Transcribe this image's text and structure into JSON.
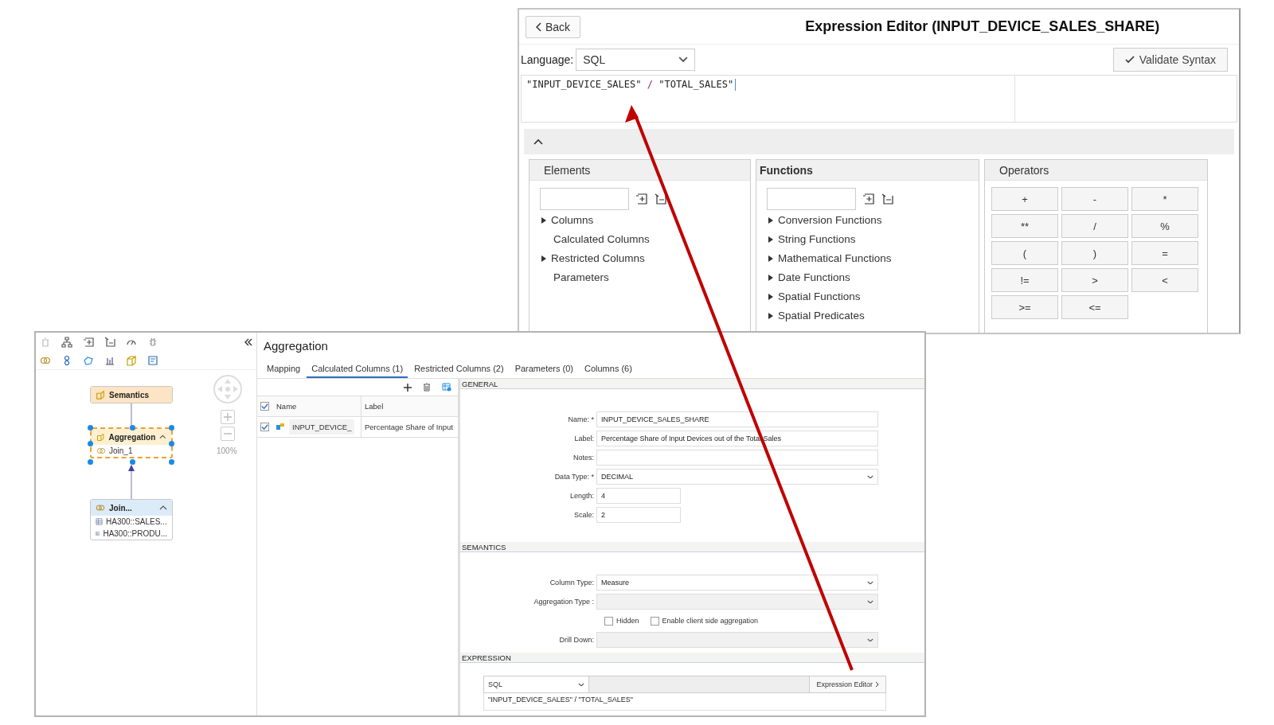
{
  "expression_editor": {
    "back_button": "Back",
    "title": "Expression Editor (INPUT_DEVICE_SALES_SHARE)",
    "language_label": "Language:",
    "language": "SQL",
    "validate_button": "Validate Syntax",
    "code": [
      {
        "kind": "string",
        "text": "\"INPUT_DEVICE_SALES\""
      },
      {
        "kind": "operator",
        "text": "/"
      },
      {
        "kind": "string",
        "text": "\"TOTAL_SALES\""
      }
    ],
    "elements": {
      "title": "Elements",
      "items": [
        {
          "label": "Columns",
          "expandable": true
        },
        {
          "label": "Calculated Columns",
          "expandable": false
        },
        {
          "label": "Restricted Columns",
          "expandable": true
        },
        {
          "label": "Parameters",
          "expandable": false
        }
      ]
    },
    "functions": {
      "title": "Functions",
      "items": [
        {
          "label": "Conversion Functions",
          "expandable": true
        },
        {
          "label": "String Functions",
          "expandable": true
        },
        {
          "label": "Mathematical Functions",
          "expandable": true
        },
        {
          "label": "Date Functions",
          "expandable": true
        },
        {
          "label": "Spatial Functions",
          "expandable": true
        },
        {
          "label": "Spatial Predicates",
          "expandable": true
        }
      ]
    },
    "operators": {
      "title": "Operators",
      "keys": [
        "+",
        "-",
        "*",
        "**",
        "/",
        "%",
        "(",
        ")",
        "=",
        "!=",
        ">",
        "<",
        ">=",
        "<="
      ]
    }
  },
  "modeler": {
    "nodes": [
      {
        "kind": "semantics",
        "label": "Semantics",
        "selected": false
      },
      {
        "kind": "aggregation",
        "label": "Aggregation",
        "selected": true,
        "inputs": [
          "Join_1"
        ]
      },
      {
        "kind": "join",
        "label": "Join...",
        "selected": false,
        "sources": [
          "HA300::SALES...",
          "HA300::PRODU..."
        ]
      }
    ],
    "zoom": "100%",
    "title": "Aggregation",
    "tabs": [
      {
        "label": "Mapping",
        "selected": false
      },
      {
        "label": "Calculated Columns (1)",
        "selected": true
      },
      {
        "label": "Restricted Columns (2)",
        "selected": false
      },
      {
        "label": "Parameters (0)",
        "selected": false
      },
      {
        "label": "Columns (6)",
        "selected": false
      }
    ],
    "list": {
      "columns": [
        "Name",
        "Label"
      ],
      "all_checked": true,
      "rows": [
        {
          "checked": true,
          "name": "INPUT_DEVICE_",
          "label": "Percentage Share of Input"
        }
      ]
    },
    "sections": [
      {
        "title": "GENERAL",
        "fields": [
          {
            "kind": "text",
            "label": "Name: *",
            "value": "INPUT_DEVICE_SALES_SHARE",
            "short": false
          },
          {
            "kind": "text",
            "label": "Label:",
            "value": "Percentage Share of Input Devices out of the Total Sales",
            "short": false
          },
          {
            "kind": "text",
            "label": "Notes:",
            "short": false
          },
          {
            "kind": "select",
            "label": "Data Type: *",
            "value": "DECIMAL",
            "disabled": false
          },
          {
            "kind": "text",
            "label": "Length:",
            "value": "4",
            "short": true
          },
          {
            "kind": "text",
            "label": "Scale:",
            "value": "2",
            "short": true
          }
        ]
      },
      {
        "title": "SEMANTICS",
        "fields": [
          {
            "kind": "select",
            "label": "Column Type:",
            "value": "Measure",
            "disabled": false
          },
          {
            "kind": "select",
            "label": "Aggregation Type :",
            "disabled": true
          },
          {
            "kind": "checks",
            "items": [
              {
                "label": "Hidden",
                "checked": false
              },
              {
                "label": "Enable client side aggregation",
                "checked": false
              }
            ]
          },
          {
            "kind": "select",
            "label": "Drill Down:",
            "disabled": true
          }
        ]
      },
      {
        "title": "EXPRESSION",
        "fields": [
          {
            "kind": "expression",
            "language": "SQL",
            "button": "Expression Editor",
            "value": "\"INPUT_DEVICE_SALES\" / \"TOTAL_SALES\""
          }
        ]
      }
    ]
  }
}
